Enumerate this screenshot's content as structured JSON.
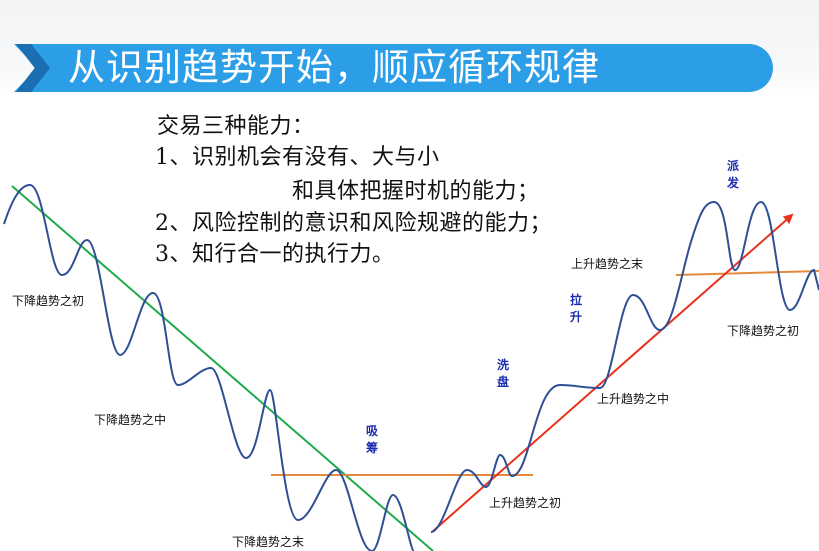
{
  "title": "从识别趋势开始，顺应循环规律",
  "text_block": {
    "heading": "交易三种能力：",
    "items": [
      "1、识别机会有没有、大与小",
      "和具体把握时机的能力；",
      "2、风险控制的意识和风险规避的能力；",
      "3、知行合一的执行力。"
    ]
  },
  "stage_labels": {
    "down_start": "下降趋势之初",
    "down_middle": "下降趋势之中",
    "down_end": "下降趋势之末",
    "up_start": "上升趋势之初",
    "up_middle": "上升趋势之中",
    "up_end": "上升趋势之末",
    "down_start_right": "下降趋势之初"
  },
  "phase_labels": {
    "accumulation": [
      "吸",
      "筹"
    ],
    "shakeout": [
      "洗",
      "盘"
    ],
    "markup": [
      "拉",
      "升"
    ],
    "distribution": [
      "派",
      "发"
    ]
  },
  "colors": {
    "banner": "#2c9ee8",
    "banner_chevron": "#1a6fb2",
    "wave": "#2f4f95",
    "down_trendline": "#1faa4a",
    "up_trendline": "#e8321e",
    "support_resistance": "#e58a3c",
    "phase_text": "#1c2db0"
  }
}
